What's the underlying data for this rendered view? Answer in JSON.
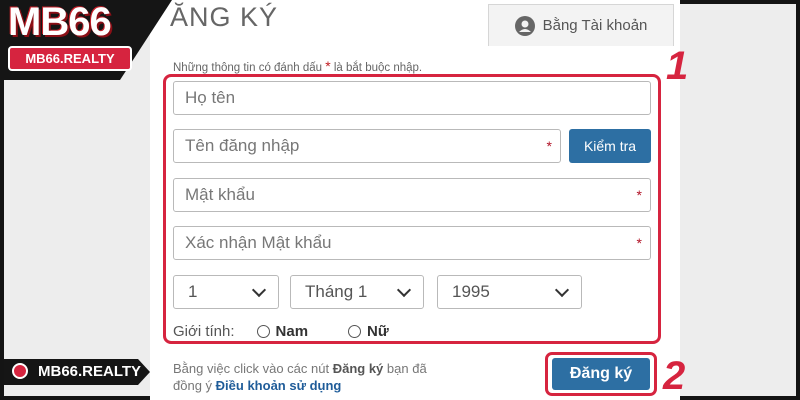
{
  "logo": {
    "title": "MB66",
    "subtitle": "MB66.REALTY"
  },
  "badge": {
    "label": "MB66.REALTY"
  },
  "header": {
    "title": "ĂNG KÝ",
    "tab_account": "Bằng Tài khoản"
  },
  "form": {
    "required_note_before": "Những thông tin có đánh dấu",
    "required_note_after": "là bắt buộc nhập.",
    "required_mark": "*",
    "fullname_placeholder": "Họ tên",
    "username_placeholder": "Tên đăng nhập",
    "check_button": "Kiểm tra",
    "password_placeholder": "Mật khẩu",
    "confirm_password_placeholder": "Xác nhận Mật khẩu",
    "birth_day": "1",
    "birth_month": "Tháng 1",
    "birth_year": "1995",
    "gender_label": "Giới tính:",
    "gender_options": [
      "Nam",
      "Nữ"
    ]
  },
  "terms": {
    "text_1": "Bằng việc click vào các nút",
    "bold": "Đăng ký",
    "text_2": "bạn đã",
    "text_3": "đồng ý",
    "link": "Điều khoản sử dụng"
  },
  "register_button": "Đăng ký",
  "step_labels": [
    "1",
    "2"
  ],
  "colors": {
    "accent_red": "#d6243f",
    "button_blue": "#2d6fa3"
  }
}
